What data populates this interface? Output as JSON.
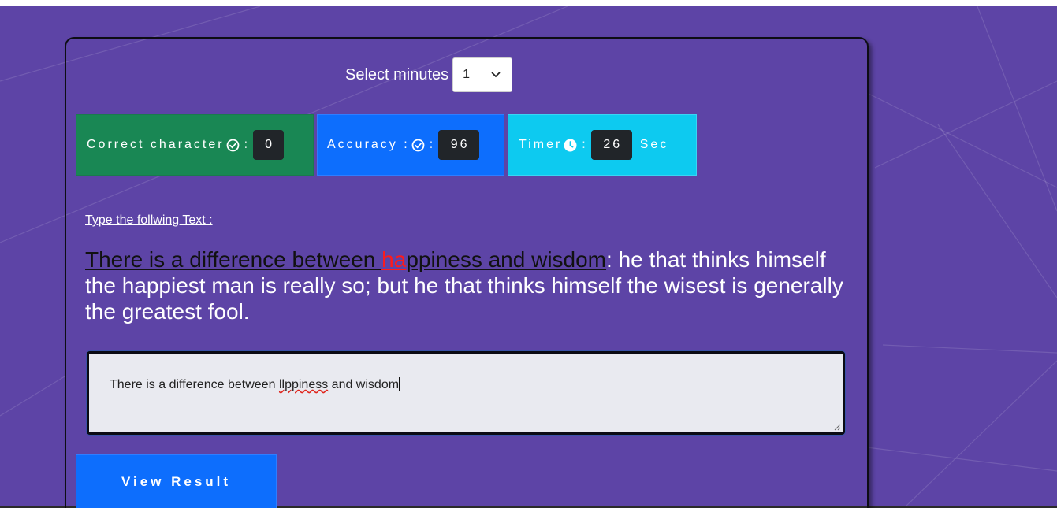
{
  "minutes": {
    "label": "Select minutes",
    "selected": "1"
  },
  "stats": {
    "correct": {
      "label": "Correct character",
      "separator": ":",
      "value": "0",
      "icon": "check-circle-icon"
    },
    "accuracy": {
      "label": "Accuracy :",
      "separator": ":",
      "value": "96",
      "icon": "check-circle-icon"
    },
    "timer": {
      "label": "Timer",
      "separator": ":",
      "value": "26",
      "unit": "Sec",
      "icon": "clock-icon"
    }
  },
  "instruction": "Type the follwing Text :",
  "passage": {
    "typed_correct": "There is a difference between ",
    "typed_error": "ha",
    "typed_rest": "ppiness and wisdom",
    "remaining": ": he that thinks himself the happiest man is really so; but he that thinks himself the wisest is generally the greatest fool."
  },
  "input": {
    "before": "There is a difference between ",
    "misspelled": "llppiness",
    "after": " and wisdom"
  },
  "result_button": "View Result",
  "colors": {
    "background": "#5d44a6",
    "correct": "#198754",
    "accuracy": "#0d6efd",
    "timer": "#0dcaf0",
    "badge": "#212529",
    "error": "#ff1a1a"
  }
}
